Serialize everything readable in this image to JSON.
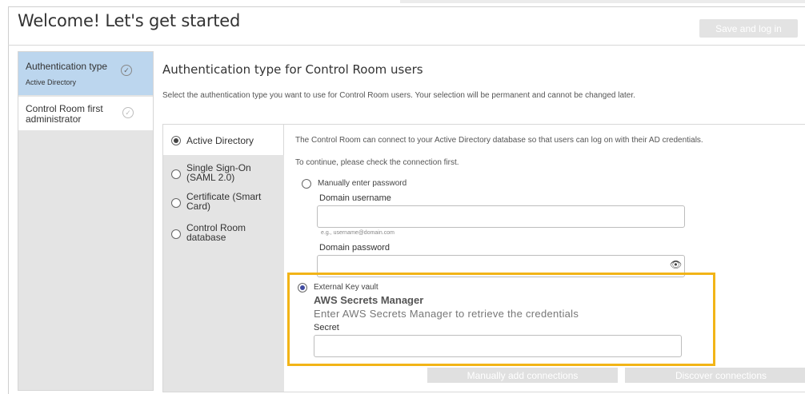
{
  "header": {
    "title": "Welcome! Let's get started",
    "save_label": "Save and log in"
  },
  "sidebar": {
    "steps": [
      {
        "label": "Authentication type",
        "sublabel": "Active Directory",
        "active": true
      },
      {
        "label": "Control Room first administrator",
        "active": false
      }
    ]
  },
  "main": {
    "title": "Authentication type for Control Room users",
    "description": "Select the authentication type you want to use for Control Room users. Your selection will be permanent and cannot be changed later.",
    "auth_options": [
      {
        "label": "Active Directory",
        "selected": true
      },
      {
        "label": "Single Sign-On (SAML 2.0)",
        "selected": false
      },
      {
        "label": "Certificate (Smart Card)",
        "selected": false
      },
      {
        "label": "Control Room database",
        "selected": false
      }
    ],
    "detail": {
      "info1": "The Control Room can connect to your Active Directory database so that users can log on with their AD credentials.",
      "info2": "To continue, please check the connection first.",
      "manual_option": "Manually enter password",
      "username_label": "Domain username",
      "username_placeholder": "e.g., username@domain.com",
      "password_label": "Domain password",
      "key_vault_option": "External Key vault",
      "key_vault_title": "AWS Secrets Manager",
      "key_vault_desc": "Enter AWS Secrets Manager to retrieve the credentials",
      "secret_label": "Secret",
      "manual_connections_label": "Manually add connections",
      "discover_connections_label": "Discover connections"
    }
  },
  "colors": {
    "highlight_border": "#f2b417",
    "active_step_bg": "#bcd6ee"
  }
}
